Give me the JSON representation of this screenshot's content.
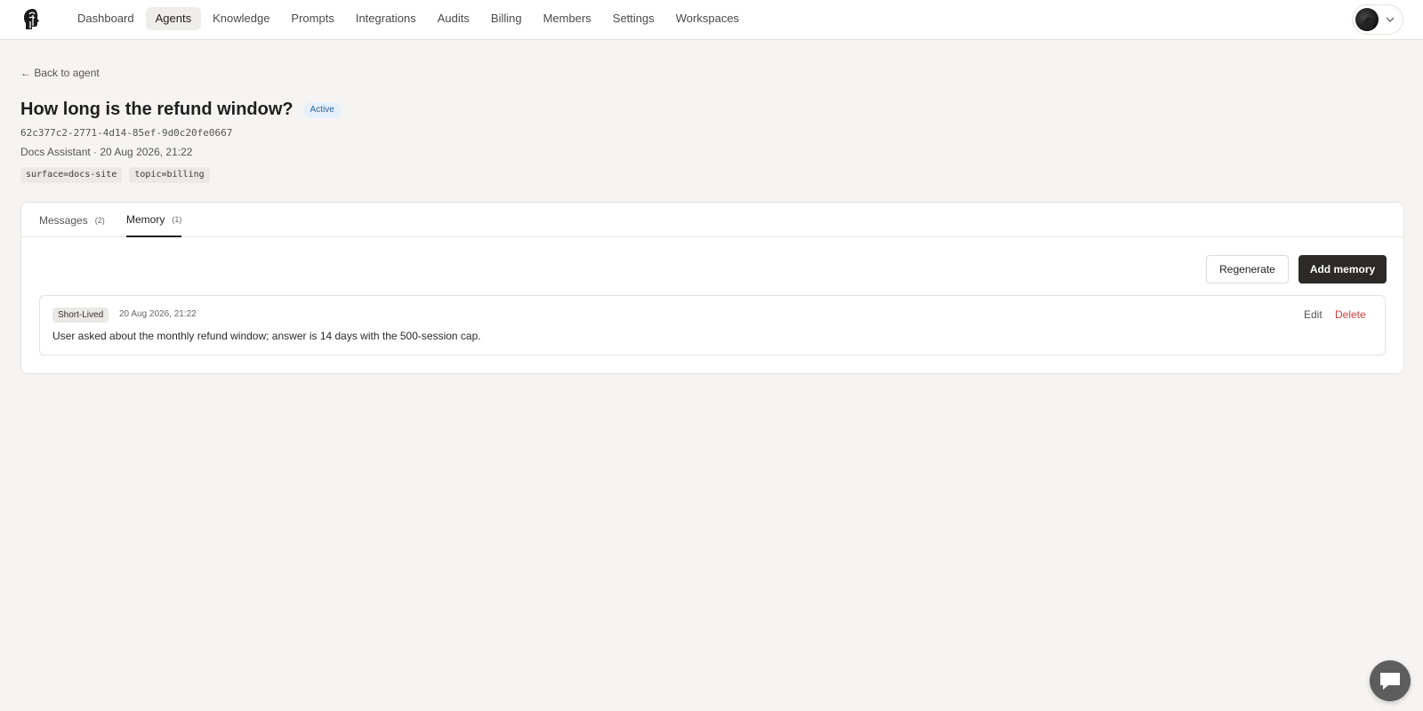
{
  "nav": {
    "items": [
      {
        "label": "Dashboard",
        "active": false
      },
      {
        "label": "Agents",
        "active": true
      },
      {
        "label": "Knowledge",
        "active": false
      },
      {
        "label": "Prompts",
        "active": false
      },
      {
        "label": "Integrations",
        "active": false
      },
      {
        "label": "Audits",
        "active": false
      },
      {
        "label": "Billing",
        "active": false
      },
      {
        "label": "Members",
        "active": false
      },
      {
        "label": "Settings",
        "active": false
      },
      {
        "label": "Workspaces",
        "active": false
      }
    ]
  },
  "back_link": "← Back to agent",
  "conversation": {
    "title": "How long is the refund window?",
    "status": "Active",
    "id": "62c377c2-2771-4d14-85ef-9d0c20fe0667",
    "meta": "Docs Assistant · 20 Aug 2026, 21:22",
    "tags": [
      "surface=docs-site",
      "topic=billing"
    ]
  },
  "tabs": [
    {
      "label": "Messages",
      "count": "(2)",
      "active": false
    },
    {
      "label": "Memory",
      "count": "(1)",
      "active": true
    }
  ],
  "actions": {
    "regenerate_label": "Regenerate",
    "add_memory_label": "Add memory"
  },
  "memories": [
    {
      "type": "Short-Lived",
      "date": "20 Aug 2026, 21:22",
      "text": "User asked about the monthly refund window; answer is 14 days with the 500-session cap.",
      "edit_label": "Edit",
      "delete_label": "Delete"
    }
  ],
  "colors": {
    "accent_dark": "#2c2a27",
    "status_badge_bg": "#e6f0fb",
    "status_badge_text": "#2c5f94",
    "delete_red": "#d23c3c",
    "page_bg": "#f5f4f2"
  }
}
